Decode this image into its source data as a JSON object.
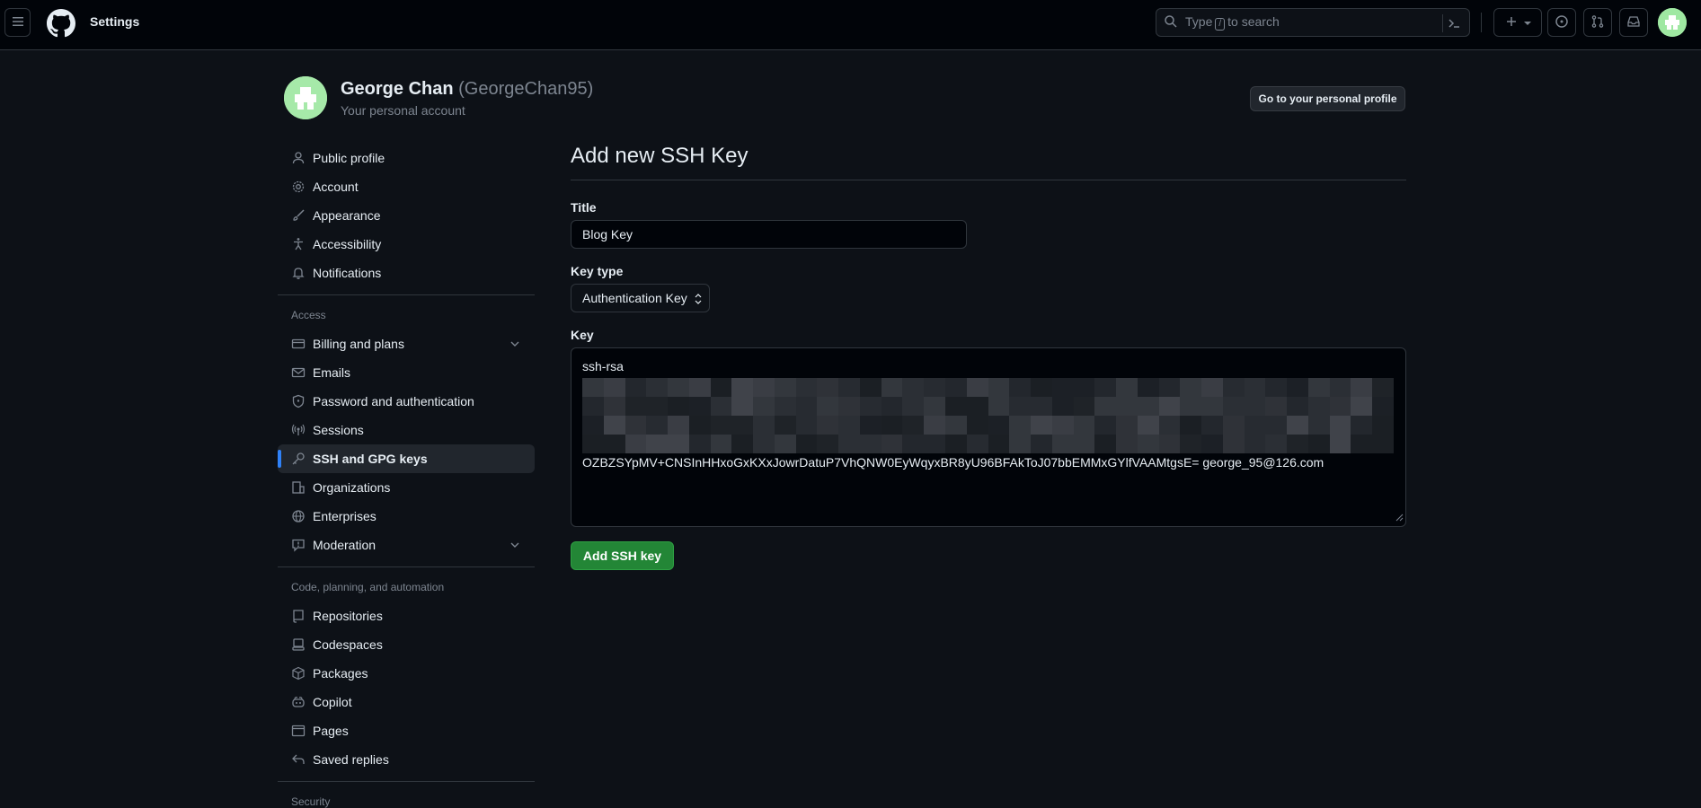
{
  "header": {
    "title": "Settings",
    "search_prefix": "Type",
    "search_key": "/",
    "search_suffix": "to search",
    "plus_icon": "plus-icon"
  },
  "profile": {
    "name": "George Chan",
    "handle": "(GeorgeChan95)",
    "subtitle": "Your personal account",
    "goto_button": "Go to your personal profile"
  },
  "sidebar": {
    "items_top": [
      {
        "label": "Public profile",
        "icon": "person-icon"
      },
      {
        "label": "Account",
        "icon": "gear-icon"
      },
      {
        "label": "Appearance",
        "icon": "paintbrush-icon"
      },
      {
        "label": "Accessibility",
        "icon": "accessibility-icon"
      },
      {
        "label": "Notifications",
        "icon": "bell-icon"
      }
    ],
    "section_access": "Access",
    "items_access": [
      {
        "label": "Billing and plans",
        "icon": "credit-card-icon"
      },
      {
        "label": "Emails",
        "icon": "mail-icon"
      },
      {
        "label": "Password and authentication",
        "icon": "shield-icon"
      },
      {
        "label": "Sessions",
        "icon": "broadcast-icon"
      },
      {
        "label": "SSH and GPG keys",
        "icon": "key-icon"
      },
      {
        "label": "Organizations",
        "icon": "organization-icon"
      },
      {
        "label": "Enterprises",
        "icon": "globe-icon"
      },
      {
        "label": "Moderation",
        "icon": "report-icon"
      }
    ],
    "section_code": "Code, planning, and automation",
    "items_code": [
      {
        "label": "Repositories",
        "icon": "repo-icon"
      },
      {
        "label": "Codespaces",
        "icon": "codespaces-icon"
      },
      {
        "label": "Packages",
        "icon": "package-icon"
      },
      {
        "label": "Copilot",
        "icon": "copilot-icon"
      },
      {
        "label": "Pages",
        "icon": "browser-icon"
      },
      {
        "label": "Saved replies",
        "icon": "reply-icon"
      }
    ],
    "section_security": "Security"
  },
  "form": {
    "heading": "Add new SSH Key",
    "title_label": "Title",
    "title_value": "Blog Key",
    "keytype_label": "Key type",
    "keytype_value": "Authentication Key",
    "key_label": "Key",
    "key_first_line": "ssh-rsa",
    "key_last_line": "OZBZSYpMV+CNSInHHxoGxKXxJowrDatuP7VhQNW0EyWqyxBR8yU96BFAkToJ07bbEMMxGYlfVAAMtgsE= george_95@126.com",
    "submit_label": "Add SSH key"
  },
  "colors": {
    "accent": "#2f81f7",
    "primary_button": "#238636",
    "background": "#0d1117",
    "header_bg": "#010409"
  }
}
